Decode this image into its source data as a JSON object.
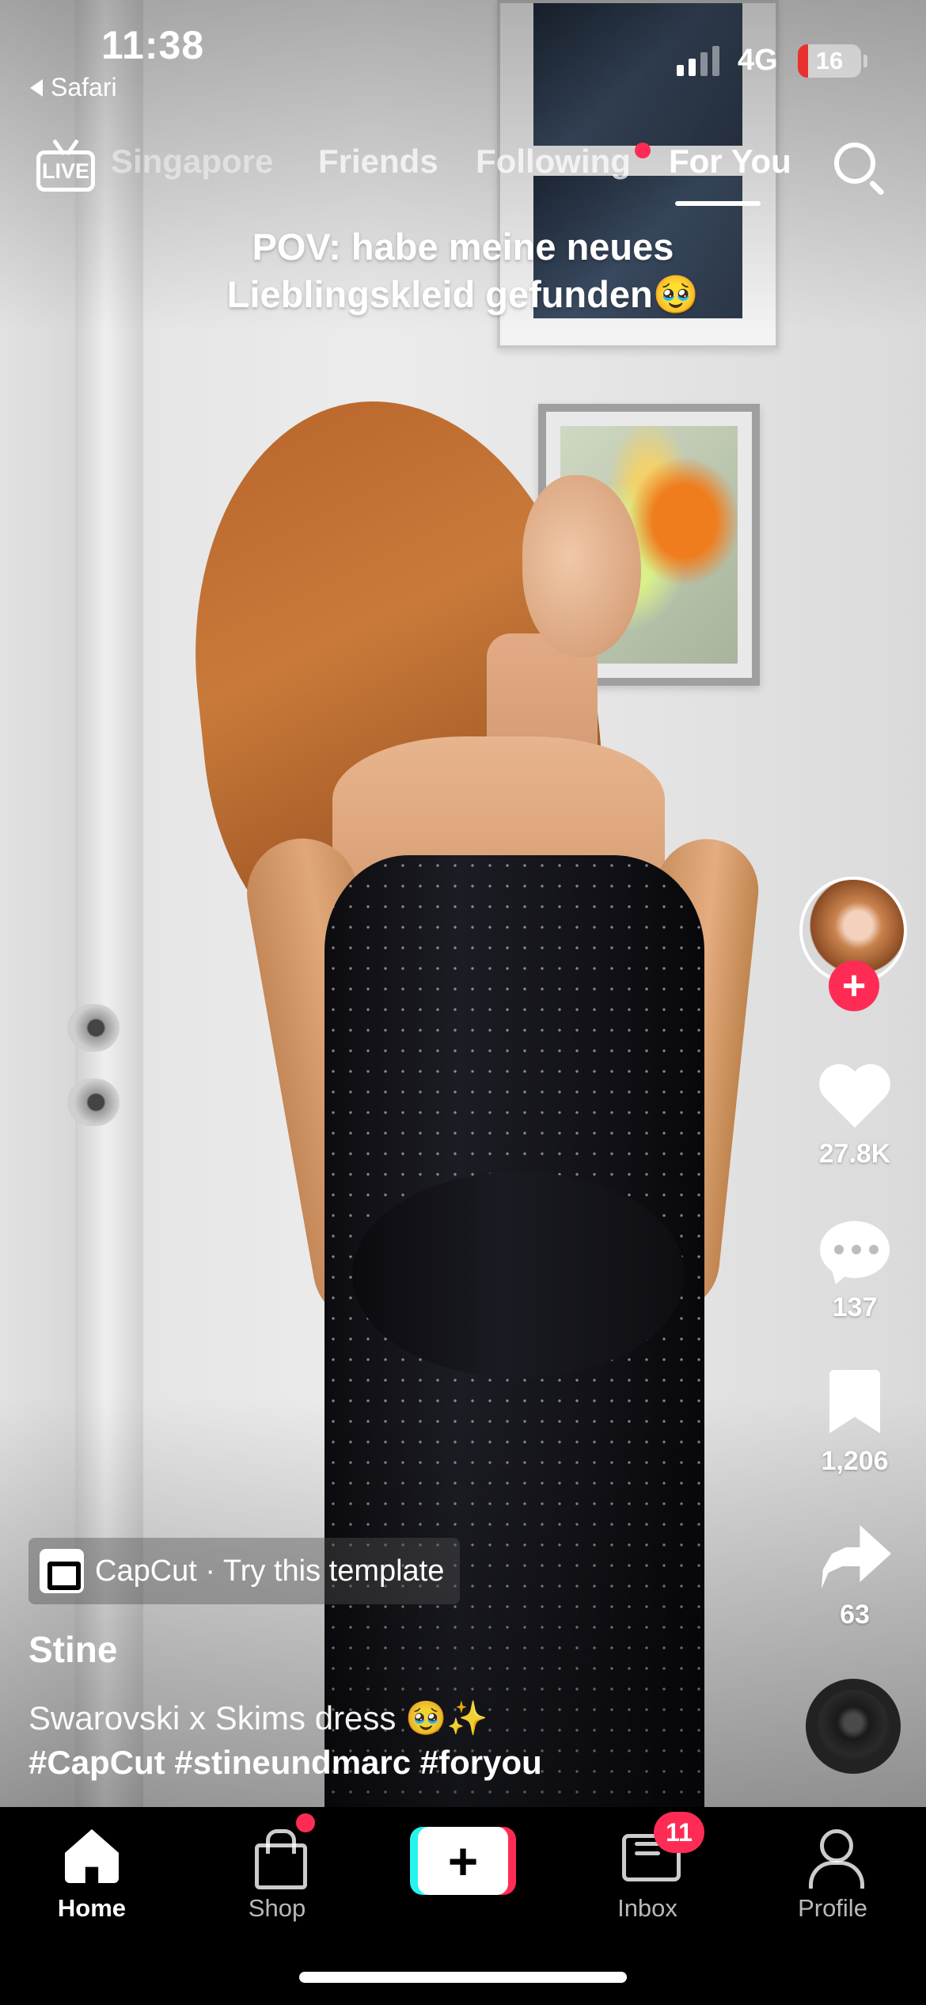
{
  "status_bar": {
    "time": "11:38",
    "back_app": "Safari",
    "network": "4G",
    "battery_percent": "16",
    "battery_level": 0.16,
    "signal_bars_active": 2,
    "signal_bars_total": 4
  },
  "top_nav": {
    "live_label": "LIVE",
    "tabs": [
      {
        "label": "Singapore",
        "state": "faded"
      },
      {
        "label": "Friends",
        "state": "inactive"
      },
      {
        "label": "Following",
        "state": "inactive",
        "has_notification_dot": true
      },
      {
        "label": "For You",
        "state": "active"
      }
    ],
    "search_icon": "search-icon"
  },
  "video": {
    "overlay_text_line1": "POV: habe meine neues",
    "overlay_text_line2": "Lieblingskleid gefunden🥹"
  },
  "right_rail": {
    "creator_avatar": "avatar",
    "follow_icon": "plus-icon",
    "likes": "27.8K",
    "comments": "137",
    "bookmarks": "1,206",
    "shares": "63",
    "sound_icon": "music-disc-icon"
  },
  "caption": {
    "template_label": "CapCut · Try this template",
    "username": "Stine",
    "description_line1": "Swarovski x Skims dress 🥹✨",
    "description_line2": "#CapCut #stineundmarc #foryou"
  },
  "tab_bar": {
    "home": "Home",
    "shop": "Shop",
    "create_icon": "plus-icon",
    "inbox": "Inbox",
    "inbox_badge": "11",
    "profile": "Profile"
  },
  "colors": {
    "accent_red": "#fe2c55",
    "accent_cyan": "#25f4ee",
    "battery_low": "#e8312f"
  }
}
